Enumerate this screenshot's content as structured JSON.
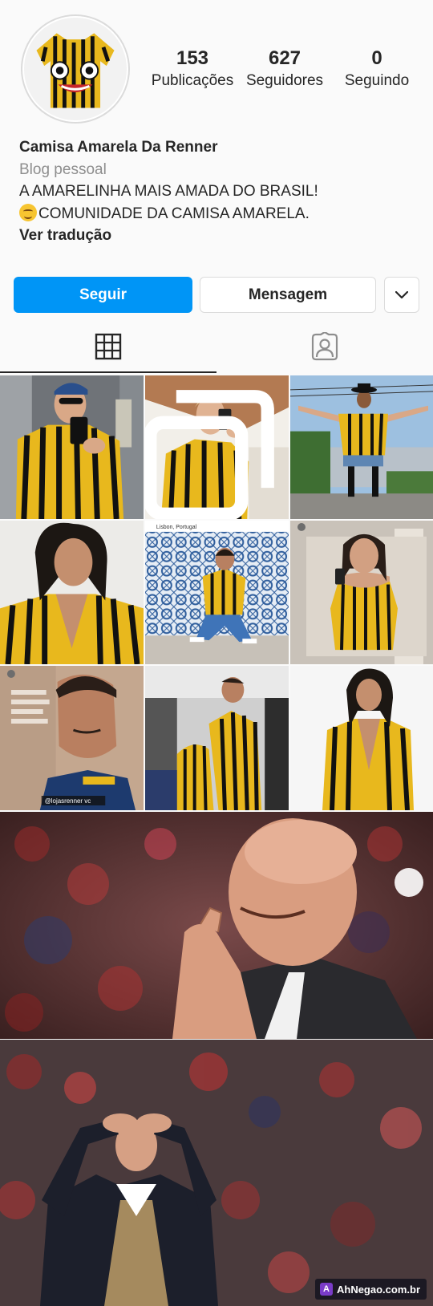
{
  "profile": {
    "stats": [
      {
        "value": "153",
        "label": "Publicações"
      },
      {
        "value": "627",
        "label": "Seguidores"
      },
      {
        "value": "0",
        "label": "Seguindo"
      }
    ],
    "name": "Camisa Amarela Da Renner",
    "category": "Blog pessoal",
    "bio_line1": "A AMARELINHA MAIS AMADA DO BRASIL!",
    "bio_line2": "COMUNIDADE DA CAMISA AMARELA.",
    "translate": "Ver tradução"
  },
  "actions": {
    "follow": "Seguir",
    "message": "Mensagem"
  },
  "tabs": {
    "grid_icon": "grid-icon",
    "tagged_icon": "tagged-icon"
  },
  "posts": [
    {
      "caption": "",
      "location": ""
    },
    {
      "caption": "",
      "location": ""
    },
    {
      "caption": "",
      "location": ""
    },
    {
      "caption": "",
      "location": ""
    },
    {
      "caption": "",
      "location": "Lisbon, Portugal"
    },
    {
      "caption": "",
      "location": ""
    },
    {
      "caption": "",
      "location": ""
    },
    {
      "caption": "",
      "location": ""
    },
    {
      "caption": "",
      "location": ""
    }
  ],
  "post7_tag": "@lojasrenner vc",
  "watermark": "AhNegao.com.br",
  "colors": {
    "accent": "#0095f6",
    "shirt_yellow": "#e8b81d",
    "shirt_stripe": "#111111"
  }
}
